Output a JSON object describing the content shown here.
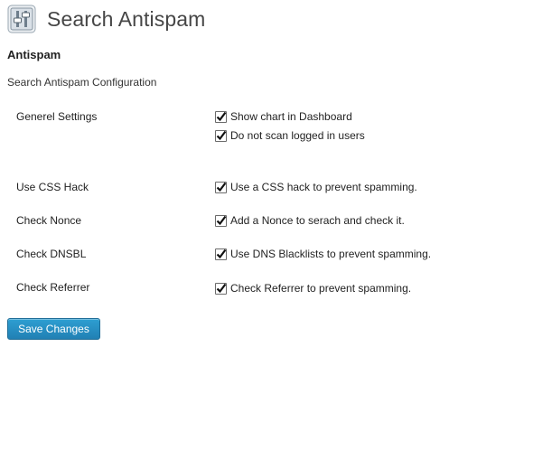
{
  "header": {
    "title": "Search Antispam",
    "icon": "settings-sliders-icon"
  },
  "section": {
    "title": "Antispam",
    "description": "Search Antispam Configuration"
  },
  "settings": {
    "general": {
      "label": "Generel Settings",
      "options": [
        {
          "label": "Show chart in Dashboard",
          "checked": true
        },
        {
          "label": "Do not scan logged in users",
          "checked": true
        }
      ]
    },
    "css_hack": {
      "label": "Use CSS Hack",
      "option": {
        "label": "Use a CSS hack to prevent spamming.",
        "checked": true
      }
    },
    "nonce": {
      "label": "Check Nonce",
      "option": {
        "label": "Add a Nonce to serach and check it.",
        "checked": true
      }
    },
    "dnsbl": {
      "label": "Check DNSBL",
      "option": {
        "label": "Use DNS Blacklists to prevent spamming.",
        "checked": true
      }
    },
    "referrer": {
      "label": "Check Referrer",
      "option": {
        "label": "Check Referrer to prevent spamming.",
        "checked": true
      }
    }
  },
  "actions": {
    "save_label": "Save Changes"
  },
  "colors": {
    "button": "#2180b4",
    "title": "#464646"
  }
}
